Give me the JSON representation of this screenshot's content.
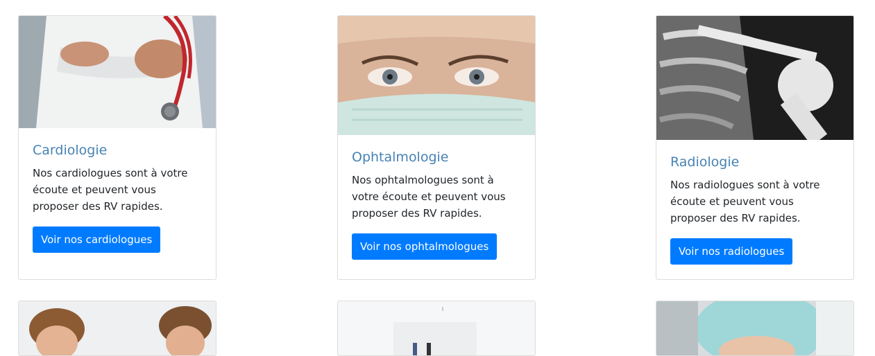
{
  "cards": [
    {
      "title": "Cardiologie",
      "text": "Nos cardiologues sont à votre écoute et peuvent vous proposer des RV rapides.",
      "button": "Voir nos cardiologues",
      "image_icon": "doctor-stethoscope-photo"
    },
    {
      "title": "Ophtalmologie",
      "text": "Nos ophtalmologues sont à votre écoute et peuvent vous proposer des RV rapides.",
      "button": "Voir nos ophtalmologues",
      "image_icon": "masked-face-eyes-photo"
    },
    {
      "title": "Radiologie",
      "text": "Nos radiologues sont à votre écoute et peuvent vous proposer des RV rapides.",
      "button": "Voir nos radiologues",
      "image_icon": "xray-shoulder-photo"
    }
  ],
  "lower_row": [
    {
      "image_icon": "children-photo"
    },
    {
      "image_icon": "clinic-room-photo"
    },
    {
      "image_icon": "surgical-cap-patient-photo"
    }
  ],
  "colors": {
    "title": "#4682b4",
    "button": "#007bff",
    "border": "#dcdcdc"
  }
}
